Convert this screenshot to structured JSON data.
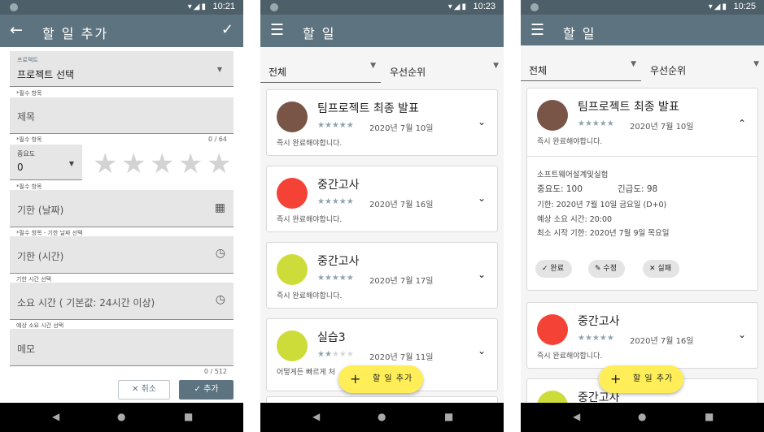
{
  "status": {
    "times": [
      "10:21",
      "10:23",
      "10:25"
    ],
    "icons": "▾◢▮"
  },
  "screen1": {
    "appbar": {
      "back_icon": "←",
      "title": "할 일 추가",
      "confirm_icon": "✓"
    },
    "project": {
      "label": "프로젝트",
      "value": "프로젝트 선택",
      "caret": "▼"
    },
    "title_field": {
      "required_helper": "*필수 항목",
      "placeholder": "제목",
      "counter": "0 / 64"
    },
    "importance": {
      "required_helper": "*필수 항목",
      "label": "중요도",
      "value": "0",
      "caret": "▼",
      "star": "★"
    },
    "deadline_date": {
      "required_helper": "*필수 항목",
      "placeholder": "기한 (날짜)",
      "icon": "▦"
    },
    "deadline_time": {
      "helper": "*필수 항목 - 기한 날짜 선택",
      "placeholder": "기한 (시간)",
      "icon": "◷"
    },
    "duration": {
      "helper": "기한 시간 선택",
      "placeholder": "소요 시간 ( 기본값: 24시간 이상)",
      "icon": "◷"
    },
    "memo": {
      "helper": "예상 소요 시간 선택",
      "placeholder": "메모",
      "counter": "0 / 512"
    },
    "cancel_button": {
      "icon": "✕",
      "label": "취소"
    },
    "add_button": {
      "icon": "✓",
      "label": "추가"
    }
  },
  "screen2": {
    "appbar": {
      "menu_icon": "☰",
      "title": "할 일"
    },
    "filter": {
      "all": "전체",
      "priority": "우선순위",
      "caret": "▼"
    },
    "cards": [
      {
        "title": "팀프로젝트 최종 발표",
        "stars": "★★★★★",
        "date": "2020년 7월 10일",
        "note": "즉시 완료해야합니다.",
        "color": "#795548",
        "chev": "⌄"
      },
      {
        "title": "중간고사",
        "stars": "★★★★★",
        "date": "2020년 7월 16일",
        "note": "즉시 완료해야합니다.",
        "color": "#f44336",
        "chev": "⌄"
      },
      {
        "title": "중간고사",
        "stars": "★★★★★",
        "date": "2020년 7월 17일",
        "note": "즉시 완료해야합니다.",
        "color": "#cddc39",
        "chev": "⌄"
      },
      {
        "title": "실습3",
        "stars_on": "★★",
        "stars_off": "★★★",
        "date": "2020년 7월 11일",
        "note": "어떻게든 빠르게 처",
        "color": "#cddc39",
        "chev": "⌄"
      }
    ],
    "fab": {
      "icon": "+",
      "label": "할 일 추가"
    }
  },
  "screen3": {
    "appbar": {
      "menu_icon": "☰",
      "title": "할 일"
    },
    "filter": {
      "all": "전체",
      "priority": "우선순위",
      "caret": "▼"
    },
    "expanded": {
      "title": "팀프로젝트 최종 발표",
      "stars": "★★★★★",
      "date": "2020년 7월 10일",
      "note": "즉시 완료해야합니다.",
      "color": "#795548",
      "chev": "⌃",
      "project": "소프트웨어설계및실험",
      "importance": "중요도: 100",
      "urgency": "긴급도: 98",
      "deadline": "기한: 2020년 7월 10일 금요일 (D+0)",
      "duration": "예상 소요 시간: 20:00",
      "start": "최소 시작 기한: 2020년 7월 9일 목요일",
      "chips": [
        {
          "icon": "✓",
          "label": "완료"
        },
        {
          "icon": "✎",
          "label": "수정"
        },
        {
          "icon": "✕",
          "label": "실패"
        }
      ]
    },
    "cards": [
      {
        "title": "중간고사",
        "stars": "★★★★★",
        "date": "2020년 7월 16일",
        "note": "즉시 완료해야합니다.",
        "color": "#f44336",
        "chev": "⌄"
      },
      {
        "title": "중간고사",
        "color": "#cddc39"
      }
    ],
    "fab": {
      "icon": "+",
      "label": "할 일 추가"
    }
  },
  "navbar": {
    "back": "◀",
    "home": "●",
    "recents": "■"
  }
}
